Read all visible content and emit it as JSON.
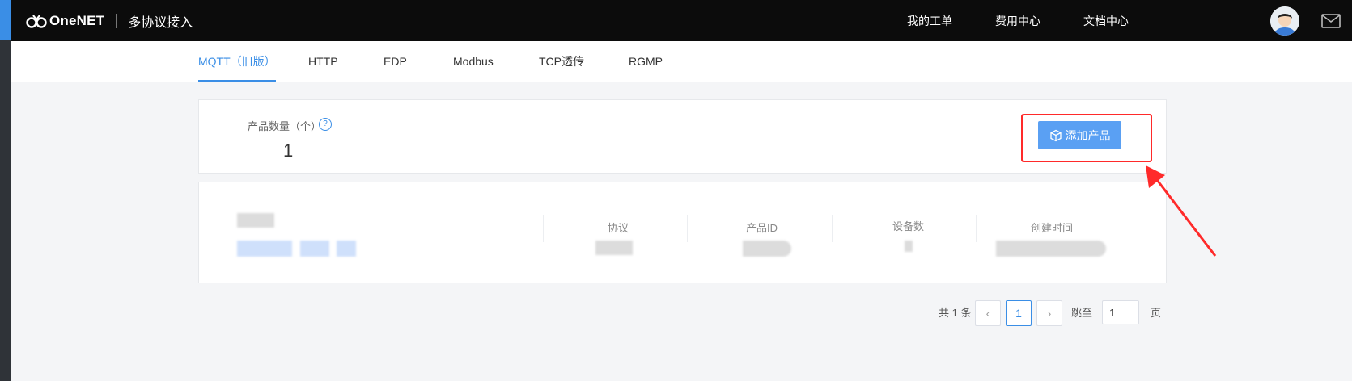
{
  "brand": {
    "logo_text": "OneNET",
    "app_title": "多协议接入"
  },
  "top_nav": [
    "我的工单",
    "费用中心",
    "文档中心"
  ],
  "tabs": [
    {
      "label": "MQTT（旧版）",
      "active": true
    },
    {
      "label": "HTTP",
      "active": false
    },
    {
      "label": "EDP",
      "active": false
    },
    {
      "label": "Modbus",
      "active": false
    },
    {
      "label": "TCP透传",
      "active": false
    },
    {
      "label": "RGMP",
      "active": false
    }
  ],
  "summary": {
    "label": "产品数量（个）",
    "help": "?",
    "value": "1",
    "add_button": "添加产品"
  },
  "product_table": {
    "headers": [
      "协议",
      "产品ID",
      "设备数",
      "创建时间"
    ]
  },
  "pagination": {
    "total": "共 1 条",
    "prev": "‹",
    "current": "1",
    "next": "›",
    "jump_label": "跳至",
    "jump_value": "1",
    "page_suffix": "页"
  },
  "colors": {
    "accent": "#3a8ee6",
    "button": "#5aa0f3",
    "highlight": "#ff2a2a",
    "topbar": "#0c0c0c"
  }
}
